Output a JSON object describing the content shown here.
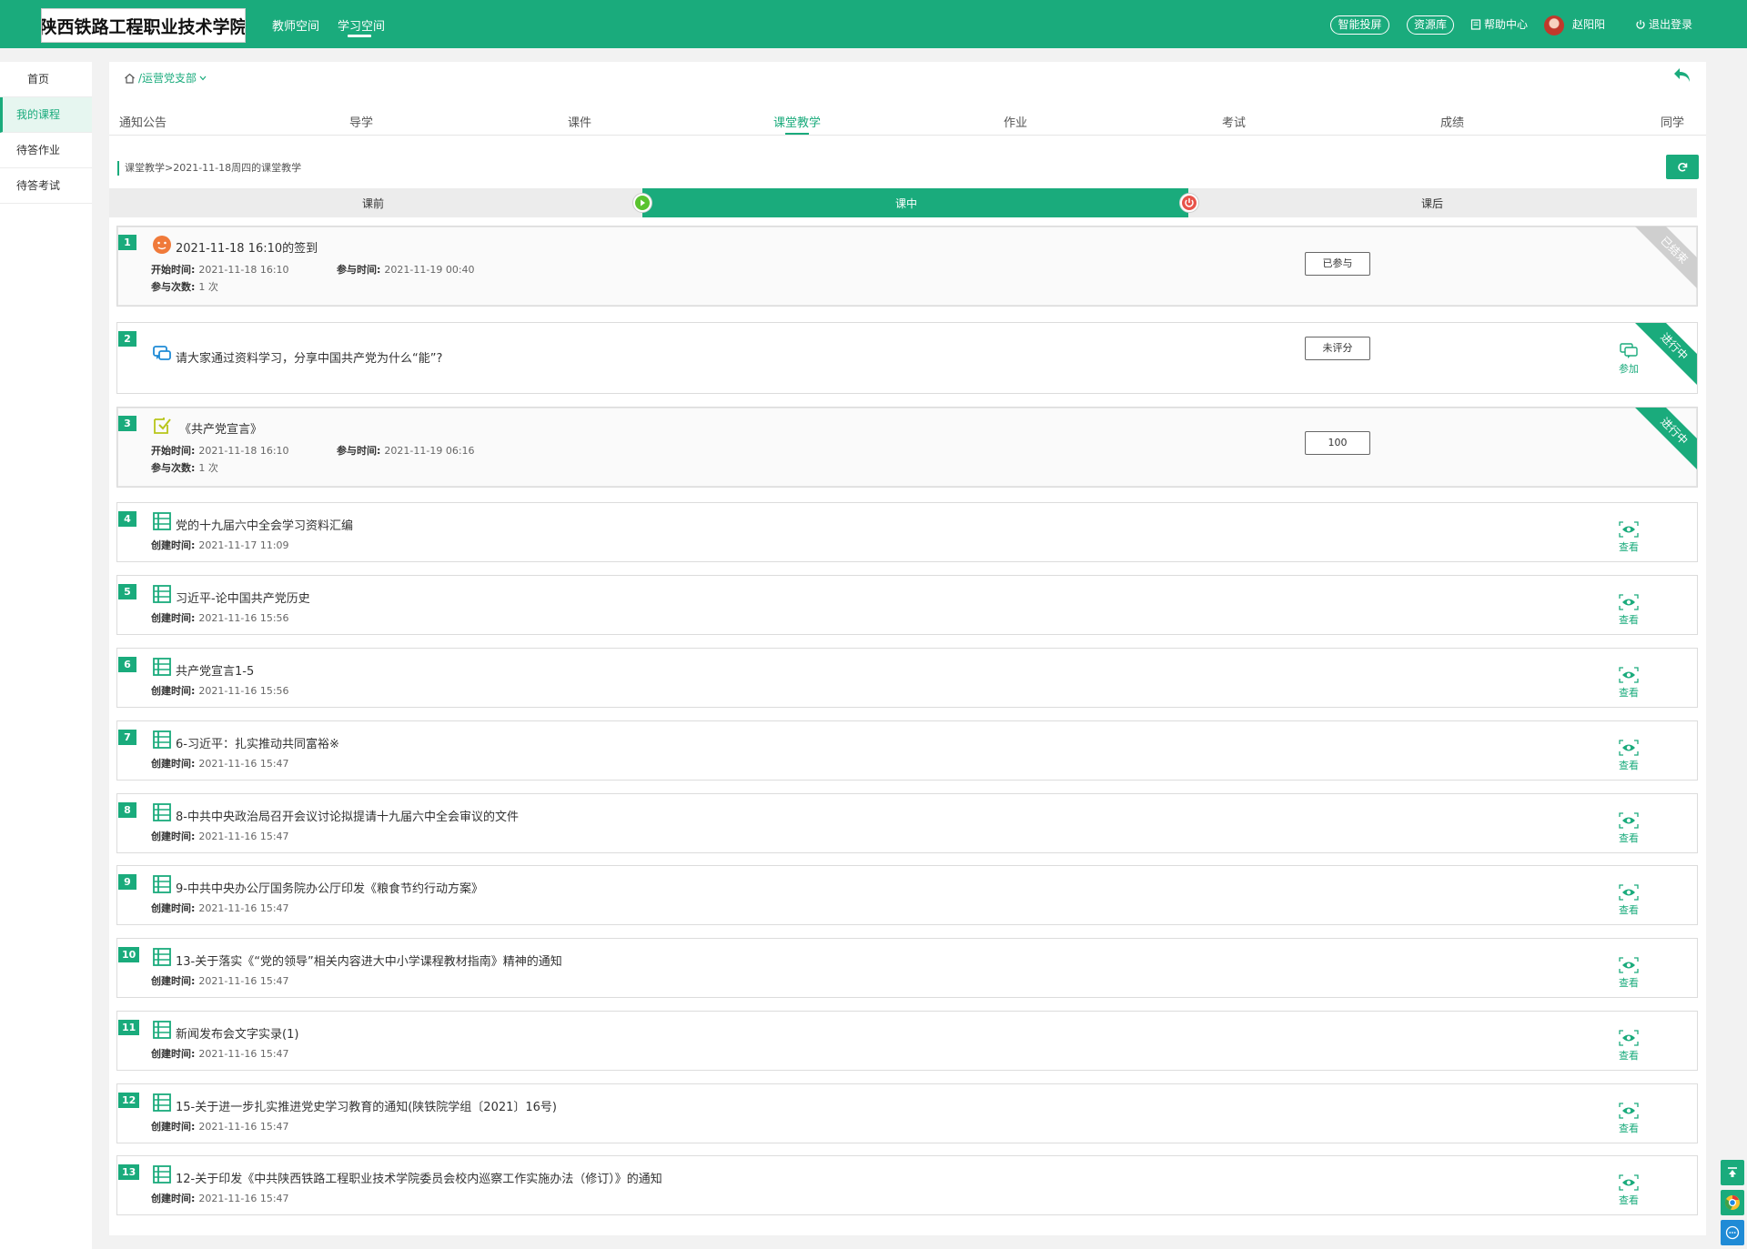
{
  "header": {
    "logo_text": "陕西铁路工程职业技术学院",
    "nav": [
      "教师空间",
      "学习空间"
    ],
    "pill_screen": "智能投屏",
    "pill_resources": "资源库",
    "help": "帮助中心",
    "username": "赵阳阳",
    "logout": "退出登录"
  },
  "sidebar": {
    "items": [
      {
        "label": "首页"
      },
      {
        "label": "我的课程"
      },
      {
        "label": "待答作业"
      },
      {
        "label": "待答考试"
      }
    ]
  },
  "main": {
    "breadcrumb": "/运营党支部",
    "tabs": [
      "通知公告",
      "导学",
      "课件",
      "课堂教学",
      "作业",
      "考试",
      "成绩",
      "同学"
    ],
    "active_tab": "课堂教学",
    "subcrumb": "课堂教学>2021-11-18周四的课堂教学",
    "phases": [
      "课前",
      "课中",
      "课后"
    ]
  },
  "activities": [
    {
      "num": "1",
      "icon": "signin-face-icon",
      "title": "2021-11-18 16:10的签到",
      "meta1_l": "开始时间:",
      "meta1_v": "2021-11-18 16:10",
      "meta1b_l": "参与时间:",
      "meta1b_v": "2021-11-19 00:40",
      "meta2_l": "参与次数:",
      "meta2_v": "1 次",
      "badge": "已参与",
      "ribbon": "已结束"
    },
    {
      "num": "2",
      "icon": "discussion-icon",
      "title": "请大家通过资料学习，分享中国共产党为什么“能”?",
      "badge": "未评分",
      "action": "参加",
      "ribbon": "进行中"
    },
    {
      "num": "3",
      "icon": "quiz-icon",
      "title": "《共产党宣言》",
      "meta1_l": "开始时间:",
      "meta1_v": "2021-11-18 16:10",
      "meta1b_l": "参与时间:",
      "meta1b_v": "2021-11-19 06:16",
      "meta2_l": "参与次数:",
      "meta2_v": "1 次",
      "badge": "100",
      "ribbon": "进行中"
    }
  ],
  "resources": {
    "meta_label": "创建时间:",
    "action": "查看",
    "items": [
      {
        "num": "4",
        "title": "党的十九届六中全会学习资料汇编",
        "created": "2021-11-17 11:09"
      },
      {
        "num": "5",
        "title": "习近平-论中国共产党历史",
        "created": "2021-11-16 15:56"
      },
      {
        "num": "6",
        "title": "共产党宣言1-5",
        "created": "2021-11-16 15:56"
      },
      {
        "num": "7",
        "title": "6-习近平：扎实推动共同富裕※",
        "created": "2021-11-16 15:47"
      },
      {
        "num": "8",
        "title": "8-中共中央政治局召开会议讨论拟提请十九届六中全会审议的文件",
        "created": "2021-11-16 15:47"
      },
      {
        "num": "9",
        "title": "9-中共中央办公厅国务院办公厅印发《粮食节约行动方案》",
        "created": "2021-11-16 15:47"
      },
      {
        "num": "10",
        "title": "13-关于落实《“党的领导”相关内容进大中小学课程教材指南》精神的通知",
        "created": "2021-11-16 15:47"
      },
      {
        "num": "11",
        "title": "新闻发布会文字实录(1)",
        "created": "2021-11-16 15:47"
      },
      {
        "num": "12",
        "title": "15-关于进一步扎实推进党史学习教育的通知(陕铁院学组〔2021〕16号)",
        "created": "2021-11-16 15:47"
      },
      {
        "num": "13",
        "title": "12-关于印发《中共陕西铁路工程职业技术学院委员会校内巡察工作实施办法（修订）》的通知",
        "created": "2021-11-16 15:47"
      }
    ]
  },
  "colors": {
    "accent": "#1aab7c",
    "ribbon_done": "#cfcfcf",
    "start": "#5ac32f",
    "end": "#e8534a"
  }
}
